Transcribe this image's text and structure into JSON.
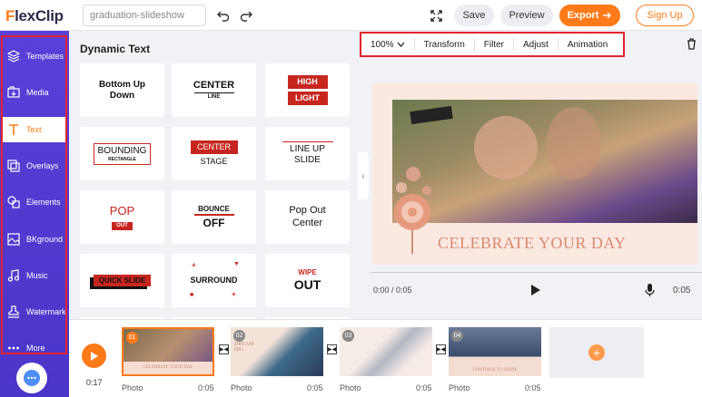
{
  "app": {
    "logo_first_letter": "F",
    "logo_rest": "lexClip",
    "project_name": "graduation-slideshow"
  },
  "header": {
    "save_label": "Save",
    "preview_label": "Preview",
    "export_label": "Export",
    "signup_label": "Sign Up"
  },
  "sidebar": {
    "items": [
      {
        "label": "Templates",
        "icon": "templates-icon"
      },
      {
        "label": "Media",
        "icon": "media-icon"
      },
      {
        "label": "Text",
        "icon": "text-icon",
        "active": true
      },
      {
        "label": "Overlays",
        "icon": "overlays-icon"
      },
      {
        "label": "Elements",
        "icon": "elements-icon"
      },
      {
        "label": "BKground",
        "icon": "background-icon"
      },
      {
        "label": "Music",
        "icon": "music-icon"
      },
      {
        "label": "Watermark",
        "icon": "watermark-icon"
      },
      {
        "label": "More",
        "icon": "more-icon"
      }
    ]
  },
  "text_panel": {
    "title": "Dynamic Text",
    "tiles": {
      "t1": "Bottom Up Down",
      "t2_main": "CENTER",
      "t2_sub": "LINE",
      "t3_top": "HIGH",
      "t3_bottom": "LIGHT",
      "t4_main": "BOUNDING",
      "t4_sub": "RECTANGLE",
      "t5_top": "CENTER",
      "t5_bottom": "STAGE",
      "t6": "LINE UP SLIDE",
      "t7_main": "POP",
      "t7_sub": "OUT",
      "t8_top": "BOUNCE",
      "t8_bottom": "OFF",
      "t9": "Pop Out Center",
      "t10": "QUICK SLIDE",
      "t11": "SURROUND",
      "t12_top": "WIPE",
      "t12_bottom": "OUT"
    }
  },
  "toolbar": {
    "zoom": "100%",
    "transform": "Transform",
    "filter": "Filter",
    "adjust": "Adjust",
    "animation": "Animation"
  },
  "canvas": {
    "headline": "CELEBRATE YOUR DAY"
  },
  "player": {
    "current_time": "0:00 / 0:05",
    "duration": "0:05"
  },
  "timeline": {
    "total_time": "0:17",
    "clips": [
      {
        "num": "01",
        "label": "Photo",
        "duration": "0:05",
        "caption": "CELEBRATE YOUR DAY"
      },
      {
        "num": "02",
        "label": "Photo",
        "duration": "0:05",
        "caption": "DREAM BIG"
      },
      {
        "num": "03",
        "label": "Photo",
        "duration": "0:05",
        "caption": ""
      },
      {
        "num": "04",
        "label": "Photo",
        "duration": "0:05",
        "caption": "CONTINUE TO SHINE"
      }
    ]
  },
  "colors": {
    "accent": "#ff7a18",
    "sidebar": "#4a36c8",
    "highlight_outline": "#e3242b",
    "text_red": "#c7261f"
  }
}
